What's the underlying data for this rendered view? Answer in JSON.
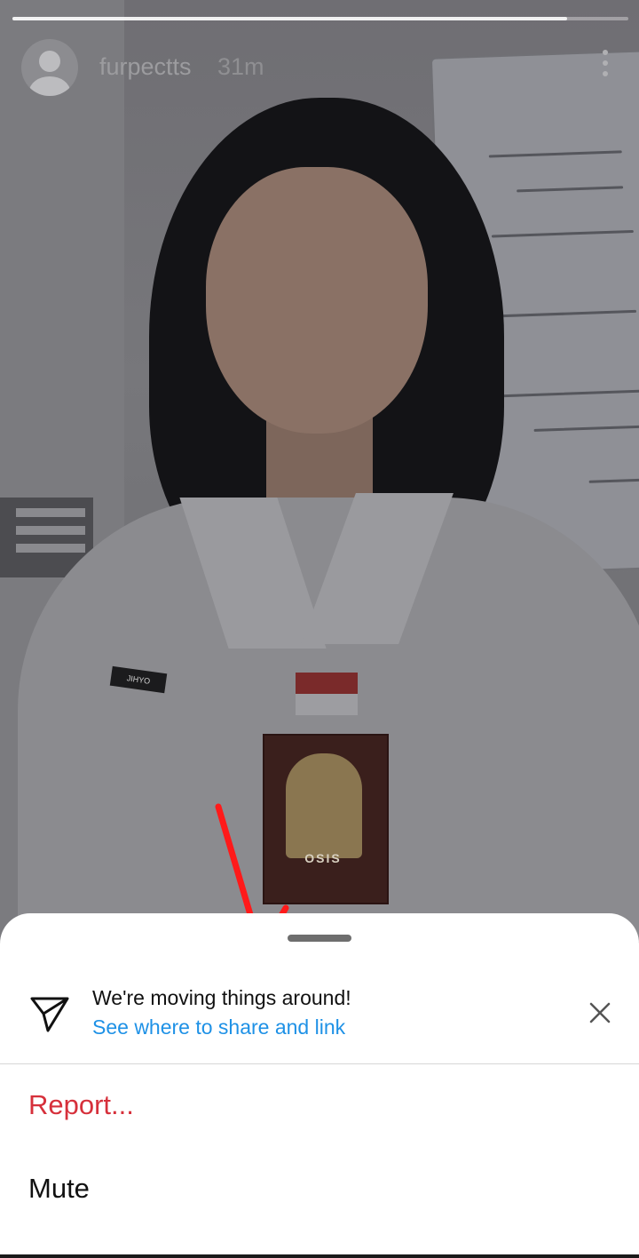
{
  "story": {
    "username": "furpectts",
    "time": "31m",
    "progress": 0.9,
    "patch_text": "OSIS",
    "name_tag_text": "JIHYO"
  },
  "sheet": {
    "notice_title": "We're moving things around!",
    "notice_link": "See where to share and link",
    "menu": {
      "report_label": "Report...",
      "mute_label": "Mute"
    }
  },
  "colors": {
    "link": "#1e91e6",
    "report": "#d6303b",
    "annotation_arrow": "#ff1a1a"
  },
  "icons": {
    "share": "paper-plane-icon",
    "close": "close-icon",
    "more": "more-vertical-icon"
  }
}
